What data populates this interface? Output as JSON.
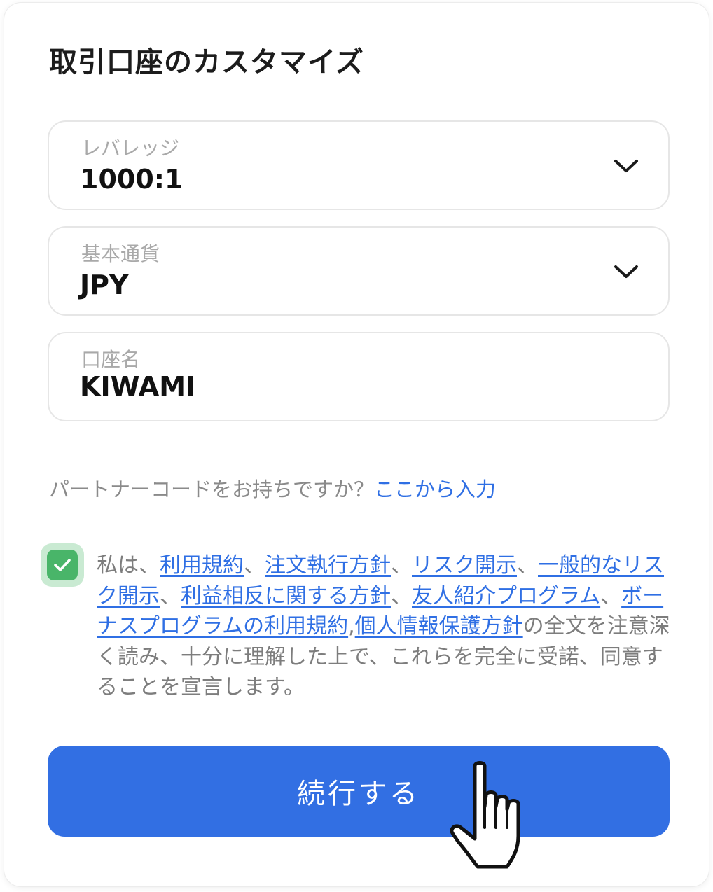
{
  "title": "取引口座のカスタマイズ",
  "fields": {
    "leverage": {
      "label": "レバレッジ",
      "value": "1000:1"
    },
    "currency": {
      "label": "基本通貨",
      "value": "JPY"
    },
    "account_name": {
      "label": "口座名",
      "value": "KIWAMI"
    }
  },
  "partner": {
    "text": "パートナーコードをお持ちですか？",
    "link": "ここから入力"
  },
  "consent": {
    "checked": true,
    "prefix": "私は、",
    "sep": "、",
    "sep_last": ",",
    "links": [
      "利用規約",
      "注文執行方針",
      "リスク開示",
      "一般的なリスク開示",
      "利益相反に関する方針",
      "友人紹介プログラム",
      "ボーナスプログラムの利用規約",
      "個人情報保護方針"
    ],
    "suffix": "の全文を注意深く読み、十分に理解した上で、これらを完全に受諾、同意することを宣言します。"
  },
  "continue_button": "続行する",
  "colors": {
    "accent": "#326fe3",
    "link": "#2f6fe4",
    "check": "#49b569"
  }
}
